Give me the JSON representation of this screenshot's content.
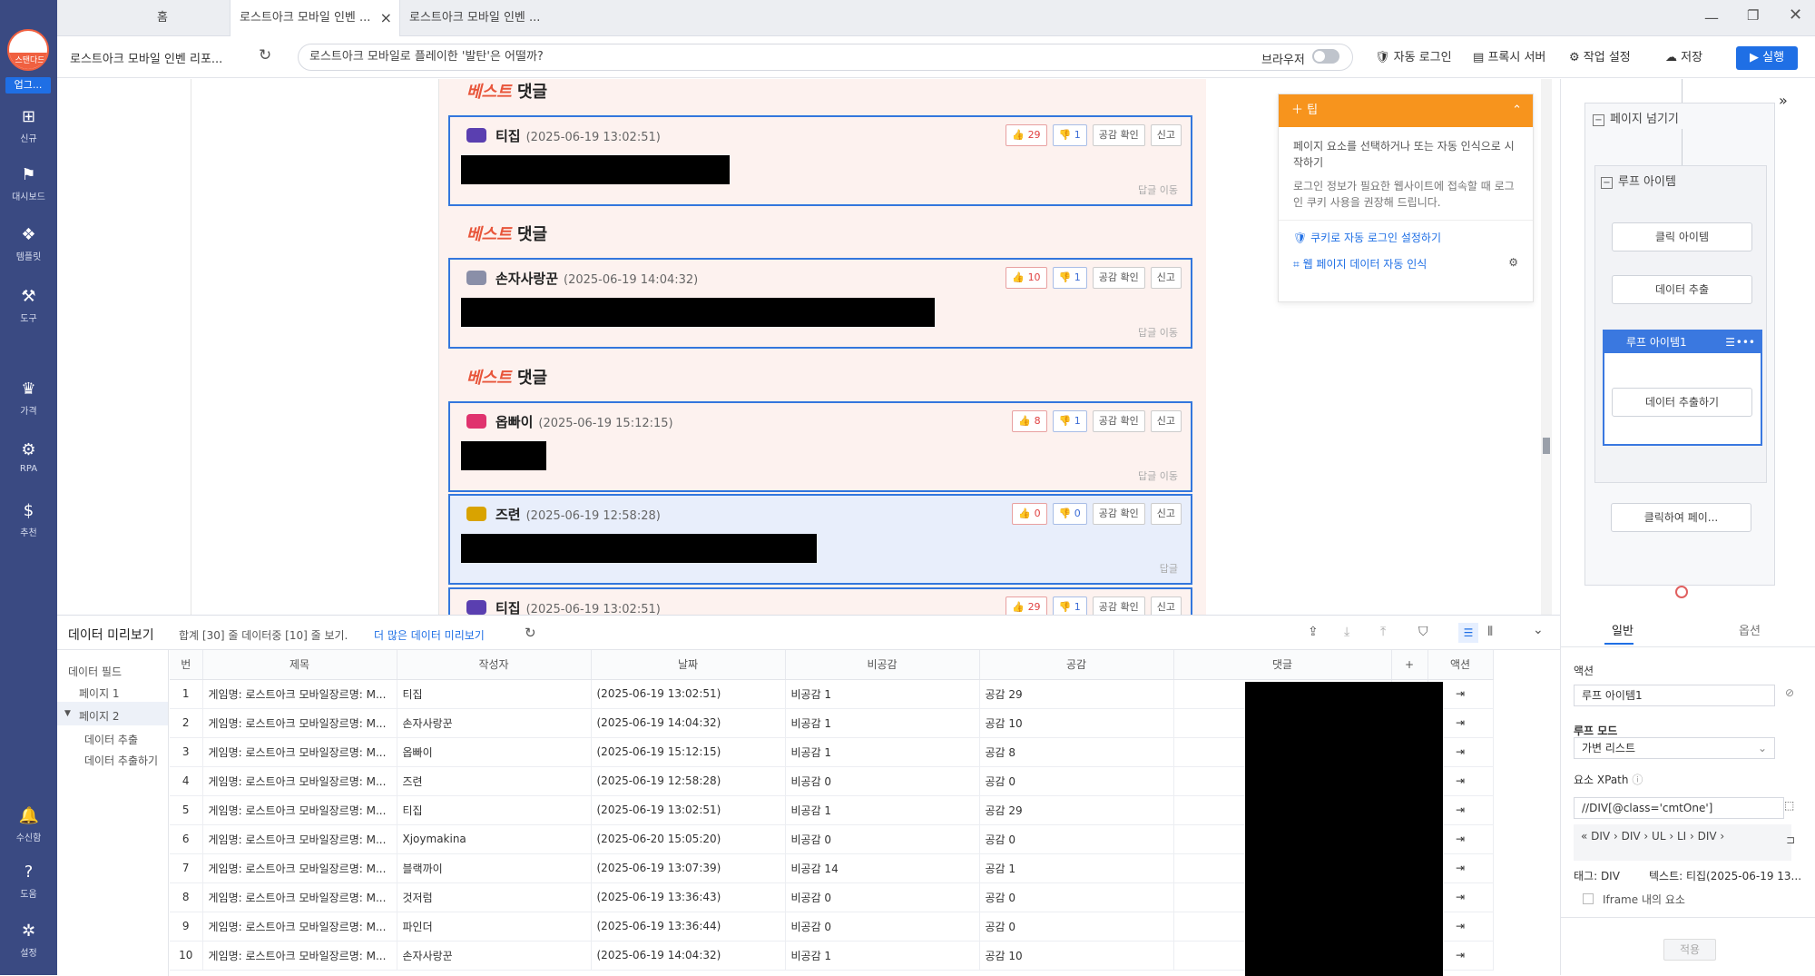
{
  "app": {
    "logo_text": "스탠다드",
    "user_badge": "업그..."
  },
  "sidebar": {
    "items": [
      {
        "label": "신규",
        "icon": "plus-square-icon"
      },
      {
        "label": "대시보드",
        "icon": "dashboard-icon"
      },
      {
        "label": "템플릿",
        "icon": "template-icon"
      },
      {
        "label": "도구",
        "icon": "toolbox-icon"
      },
      {
        "label": "가격",
        "icon": "crown-icon"
      },
      {
        "label": "RPA",
        "icon": "robot-icon"
      },
      {
        "label": "추천",
        "icon": "dollar-icon"
      }
    ],
    "bottom": [
      {
        "label": "수신함",
        "icon": "bell-icon"
      },
      {
        "label": "도움",
        "icon": "help-icon"
      },
      {
        "label": "설정",
        "icon": "gear-icon"
      }
    ]
  },
  "tabs": [
    {
      "label": "홈"
    },
    {
      "label": "로스트아크 모바일 인벤 ..."
    },
    {
      "label": "로스트아크 모바일 인벤 ..."
    }
  ],
  "address": {
    "page_title": "로스트아크 모바일 인벤 리포...",
    "url": "로스트아크 모바일로 플레이한 '발탄'은 어떨까?",
    "browser_label": "브라우저",
    "auto_login": "자동 로그인",
    "proxy": "프록시 서버",
    "task_settings": "작업 설정",
    "save": "저장",
    "run": "실행"
  },
  "comments": [
    {
      "best": true,
      "nick": "티집",
      "date": "(2025-06-19 13:02:51)",
      "up": "29",
      "down": "1",
      "check": "공감 확인",
      "report": "신고",
      "reply": "답글",
      "move": "이동",
      "badge_color": "#5a3fb0",
      "selected": false
    },
    {
      "best": true,
      "nick": "손자사랑꾼",
      "date": "(2025-06-19 14:04:32)",
      "up": "10",
      "down": "1",
      "check": "공감 확인",
      "report": "신고",
      "reply": "답글",
      "move": "이동",
      "badge_color": "#8a8fa8",
      "selected": false
    },
    {
      "best": true,
      "nick": "옵빠이",
      "date": "(2025-06-19 15:12:15)",
      "up": "8",
      "down": "1",
      "check": "공감 확인",
      "report": "신고",
      "reply": "답글",
      "move": "이동",
      "badge_color": "#e0336e",
      "selected": false
    },
    {
      "best": false,
      "nick": "즈련",
      "date": "(2025-06-19 12:58:28)",
      "up": "0",
      "down": "0",
      "check": "공감 확인",
      "report": "신고",
      "reply": "답글",
      "move": "",
      "badge_color": "#d9a300",
      "selected": true
    },
    {
      "best": false,
      "nick": "티집",
      "date": "(2025-06-19 13:02:51)",
      "up": "29",
      "down": "1",
      "check": "공감 확인",
      "report": "신고",
      "reply": "",
      "move": "",
      "badge_color": "#5a3fb0",
      "selected": false
    }
  ],
  "best_label": {
    "a": "베스트",
    "b": "댓글"
  },
  "tip": {
    "title": "팁",
    "p1": "페이지 요소를 선택하거나 또는 자동 인식으로 시작하기",
    "p2": "로그인 정보가 필요한 웹사이트에 접속할 때 로그인 쿠키 사용을 권장해 드립니다.",
    "link1": "쿠키로 자동 로그인 설정하기",
    "link2": "웹 페이지 데이터 자동 인식"
  },
  "flow": {
    "page_turn": "페이지 넘기기",
    "loop": "루프 아이템",
    "click_item": "클릭 아이템",
    "extract": "데이터 추출",
    "loop1": "루프 아이템1",
    "extract2": "데이터 추출하기",
    "click_page": "클릭하여 페이..."
  },
  "preview": {
    "title": "데이터 미리보기",
    "summary": "합계 [30] 줄 데이터중 [10] 줄 보기.",
    "more": "더 많은 데이터 미리보기",
    "tree": {
      "root": "데이터 필드",
      "page1": "페이지 1",
      "page2": "페이지 2",
      "c1": "데이터 추출",
      "c2": "데이터 추출하기"
    },
    "columns": [
      "번",
      "제목",
      "작성자",
      "날짜",
      "비공감",
      "공감",
      "댓글",
      "+",
      "액션"
    ],
    "rows": [
      [
        "1",
        "게임명: 로스트아크 모바일장르명: M...",
        "티집",
        "(2025-06-19 13:02:51)",
        "비공감 1",
        "공감 29"
      ],
      [
        "2",
        "게임명: 로스트아크 모바일장르명: M...",
        "손자사랑꾼",
        "(2025-06-19 14:04:32)",
        "비공감 1",
        "공감 10"
      ],
      [
        "3",
        "게임명: 로스트아크 모바일장르명: M...",
        "옵빠이",
        "(2025-06-19 15:12:15)",
        "비공감 1",
        "공감 8"
      ],
      [
        "4",
        "게임명: 로스트아크 모바일장르명: M...",
        "즈련",
        "(2025-06-19 12:58:28)",
        "비공감 0",
        "공감 0"
      ],
      [
        "5",
        "게임명: 로스트아크 모바일장르명: M...",
        "티집",
        "(2025-06-19 13:02:51)",
        "비공감 1",
        "공감 29"
      ],
      [
        "6",
        "게임명: 로스트아크 모바일장르명: M...",
        "Xjoymakina",
        "(2025-06-20 15:05:20)",
        "비공감 0",
        "공감 0"
      ],
      [
        "7",
        "게임명: 로스트아크 모바일장르명: M...",
        "블랙까이",
        "(2025-06-19 13:07:39)",
        "비공감 14",
        "공감 1"
      ],
      [
        "8",
        "게임명: 로스트아크 모바일장르명: M...",
        "것저럼",
        "(2025-06-19 13:36:43)",
        "비공감 0",
        "공감 0"
      ],
      [
        "9",
        "게임명: 로스트아크 모바일장르명: M...",
        "파인더",
        "(2025-06-19 13:36:44)",
        "비공감 0",
        "공감 0"
      ],
      [
        "10",
        "게임명: 로스트아크 모바일장르명: M...",
        "손자사랑꾼",
        "(2025-06-19 14:04:32)",
        "비공감 1",
        "공감 10"
      ]
    ]
  },
  "props": {
    "tab_general": "일반",
    "tab_options": "옵션",
    "action_label": "액션",
    "action_value": "루프 아이템1",
    "mode_label": "루프 모드",
    "mode_value": "가변 리스트",
    "xpath_label": "요소 XPath",
    "xpath_value": "//DIV[@class='cmtOne']",
    "crumbs": [
      "DIV",
      "DIV",
      "UL",
      "LI",
      "DIV"
    ],
    "tag": "태그: DIV",
    "text": "텍스트: 티집(2025-06-19 13...",
    "iframe": "Iframe 내의 요소",
    "apply": "적용"
  },
  "colors": {
    "sidebar": "#3a4a82",
    "accent": "#1f6fe5",
    "tip": "#f7941d",
    "best": "#e8553a"
  }
}
